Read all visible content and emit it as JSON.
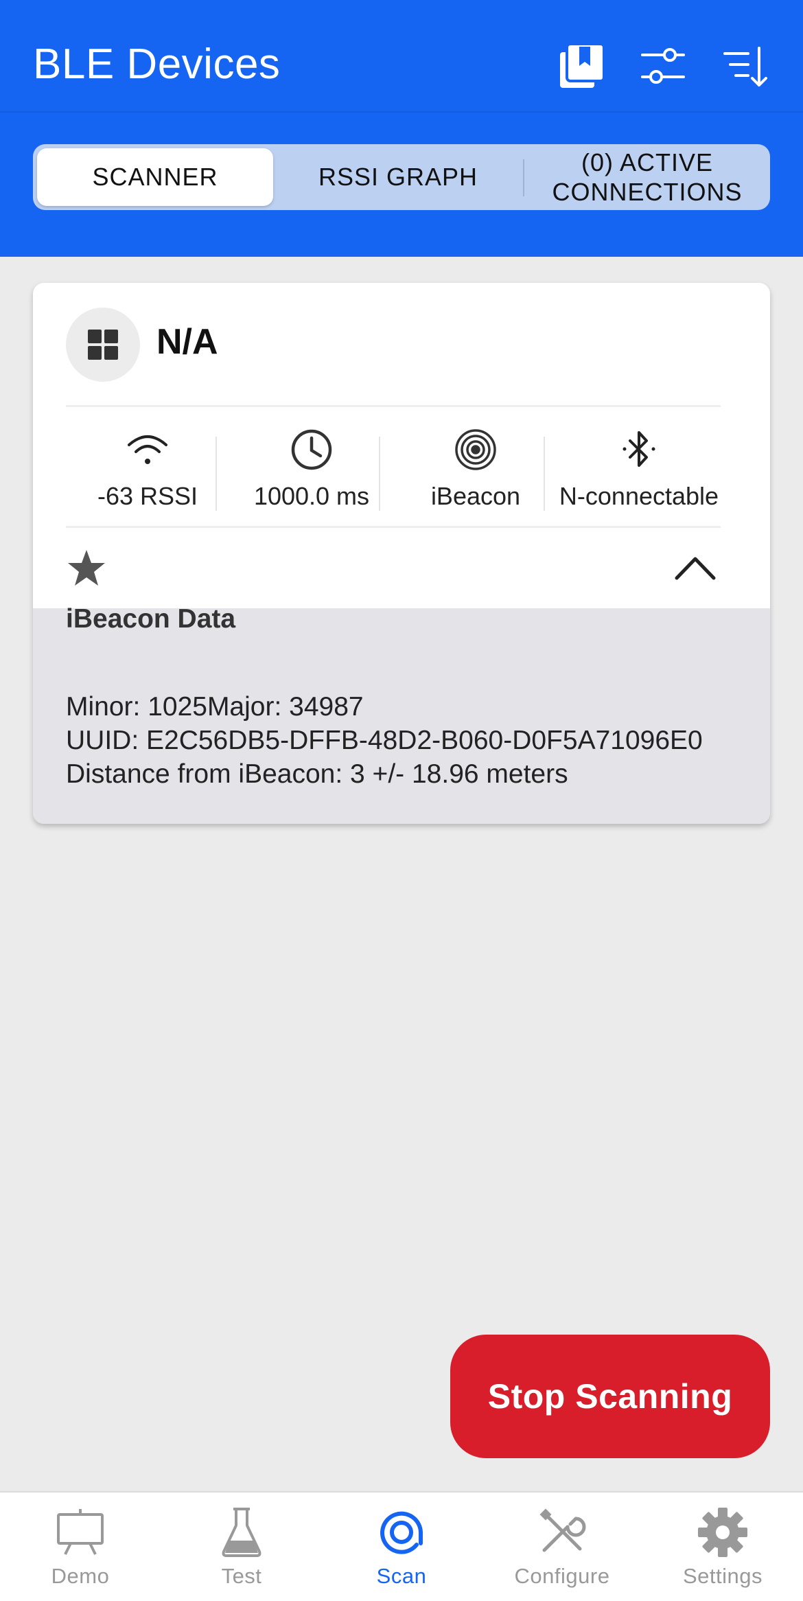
{
  "header": {
    "title": "BLE Devices",
    "icons": [
      "bookmarks-icon",
      "filter-sliders-icon",
      "sort-icon"
    ]
  },
  "tabs": [
    {
      "label": "SCANNER",
      "active": true
    },
    {
      "label": "RSSI GRAPH",
      "active": false
    },
    {
      "label": "(0) ACTIVE CONNECTIONS",
      "active": false
    }
  ],
  "device": {
    "name": "N/A",
    "rssi": "-63 RSSI",
    "interval": "1000.0 ms",
    "beacon_type": "iBeacon",
    "connectable": "N-connectable",
    "favorite": true,
    "expanded": true
  },
  "beacon_data": {
    "title": "iBeacon Data",
    "minor_major": "Minor: 1025Major: 34987",
    "uuid": "UUID: E2C56DB5-DFFB-48D2-B060-D0F5A71096E0",
    "distance": "Distance from iBeacon: 3 +/- 18.96 meters"
  },
  "stop_button": "Stop Scanning",
  "nav": [
    {
      "label": "Demo",
      "icon": "presentation-icon",
      "active": false
    },
    {
      "label": "Test",
      "icon": "flask-icon",
      "active": false
    },
    {
      "label": "Scan",
      "icon": "scan-icon",
      "active": true
    },
    {
      "label": "Configure",
      "icon": "tools-icon",
      "active": false
    },
    {
      "label": "Settings",
      "icon": "gear-icon",
      "active": false
    }
  ],
  "colors": {
    "primary": "#1565f2",
    "danger": "#d91e2b",
    "background": "#ebebec"
  }
}
